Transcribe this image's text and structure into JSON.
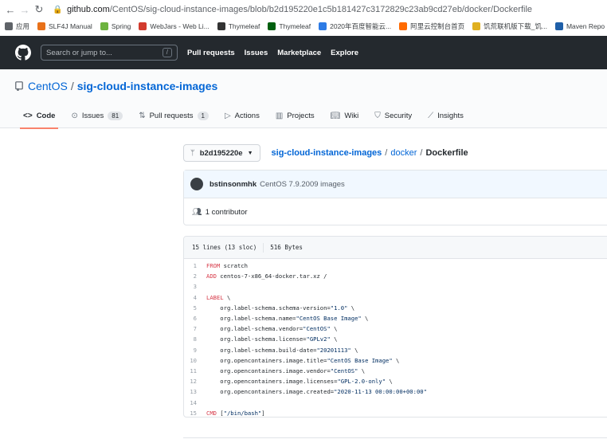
{
  "browser": {
    "url_host": "github.com",
    "url_path": "/CentOS/sig-cloud-instance-images/blob/b2d195220e1c5b181427c3172829c23ab9cd27eb/docker/Dockerfile",
    "bookmarks": [
      {
        "label": "应用",
        "icon": "apps-grid-icon",
        "color": "#5f6368"
      },
      {
        "label": "SLF4J Manual",
        "icon": "slf4j-icon",
        "color": "#e8711a"
      },
      {
        "label": "Spring",
        "icon": "spring-icon",
        "color": "#6db33f"
      },
      {
        "label": "WebJars - Web Li...",
        "icon": "webjars-icon",
        "color": "#d23b2e"
      },
      {
        "label": "Thymeleaf",
        "icon": "thymeleaf-icon",
        "color": "#333333"
      },
      {
        "label": "Thymeleaf",
        "icon": "thymeleaf-leaf-icon",
        "color": "#005f0f"
      },
      {
        "label": "2020年百度智能云...",
        "icon": "baidu-cloud-icon",
        "color": "#2d7be5"
      },
      {
        "label": "阿里云控制台首页",
        "icon": "aliyun-icon",
        "color": "#ff6a00"
      },
      {
        "label": "饥荒联机版下载_饥...",
        "icon": "game-icon",
        "color": "#e0b020"
      },
      {
        "label": "Maven Repo",
        "icon": "maven-icon",
        "color": "#1f5fa8"
      }
    ]
  },
  "header": {
    "search_placeholder": "Search or jump to...",
    "search_shortcut": "/",
    "nav": [
      "Pull requests",
      "Issues",
      "Marketplace",
      "Explore"
    ]
  },
  "repo": {
    "owner": "CentOS",
    "separator": "/",
    "name": "sig-cloud-instance-images",
    "tabs": [
      {
        "label": "Code",
        "icon": "code-icon",
        "active": true
      },
      {
        "label": "Issues",
        "icon": "issue-icon",
        "count": "81"
      },
      {
        "label": "Pull requests",
        "icon": "pull-request-icon",
        "count": "1"
      },
      {
        "label": "Actions",
        "icon": "play-icon"
      },
      {
        "label": "Projects",
        "icon": "project-icon"
      },
      {
        "label": "Wiki",
        "icon": "book-icon"
      },
      {
        "label": "Security",
        "icon": "shield-icon"
      },
      {
        "label": "Insights",
        "icon": "graph-icon"
      }
    ]
  },
  "breadcrumb": {
    "branch": "b2d195220e",
    "repo": "sig-cloud-instance-images",
    "dir": "docker",
    "file": "Dockerfile"
  },
  "commit": {
    "author": "bstinsonmhk",
    "message": "CentOS 7.9.2009 images",
    "contributors": "1 contributor"
  },
  "file": {
    "lines_info": "15 lines (13 sloc)",
    "size": "516 Bytes",
    "lines": [
      {
        "n": "1",
        "kw": "FROM",
        "rest": " scratch"
      },
      {
        "n": "2",
        "kw": "ADD",
        "rest": " centos-7-x86_64-docker.tar.xz /"
      },
      {
        "n": "3",
        "kw": "",
        "rest": ""
      },
      {
        "n": "4",
        "kw": "LABEL",
        "rest": " \\"
      },
      {
        "n": "5",
        "kw": "",
        "rest": "    org.label-schema.schema-version=\"1.0\" \\"
      },
      {
        "n": "6",
        "kw": "",
        "rest": "    org.label-schema.name=\"CentOS Base Image\" \\"
      },
      {
        "n": "7",
        "kw": "",
        "rest": "    org.label-schema.vendor=\"CentOS\" \\"
      },
      {
        "n": "8",
        "kw": "",
        "rest": "    org.label-schema.license=\"GPLv2\" \\"
      },
      {
        "n": "9",
        "kw": "",
        "rest": "    org.label-schema.build-date=\"20201113\" \\"
      },
      {
        "n": "10",
        "kw": "",
        "rest": "    org.opencontainers.image.title=\"CentOS Base Image\" \\"
      },
      {
        "n": "11",
        "kw": "",
        "rest": "    org.opencontainers.image.vendor=\"CentOS\" \\"
      },
      {
        "n": "12",
        "kw": "",
        "rest": "    org.opencontainers.image.licenses=\"GPL-2.0-only\" \\"
      },
      {
        "n": "13",
        "kw": "",
        "rest": "    org.opencontainers.image.created=\"2020-11-13 00:00:00+00:00\""
      },
      {
        "n": "14",
        "kw": "",
        "rest": ""
      },
      {
        "n": "15",
        "kw": "CMD",
        "rest": " [\"/bin/bash\"]"
      }
    ]
  }
}
